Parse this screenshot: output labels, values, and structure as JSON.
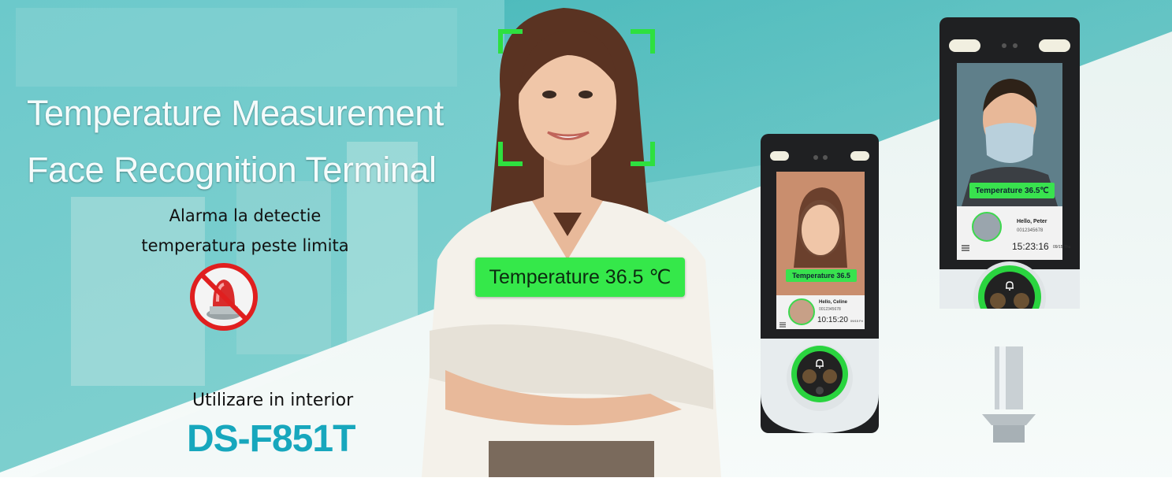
{
  "banner": {
    "title_line1": "Temperature Measurement",
    "title_line2": "Face Recognition Terminal",
    "alarm_line1": "Alarma la detectie",
    "alarm_line2": "temperatura peste limita",
    "indoor_label": "Utilizare in interior",
    "model_name": "DS-F851T",
    "temperature_badge": "Temperature 36.5 ℃"
  },
  "device_left": {
    "temperature": "Temperature 36.5",
    "greeting": "Hello, Celine",
    "id_number": "0012345678",
    "time": "10:15:20",
    "date": "09/15 Fri"
  },
  "device_right": {
    "temperature": "Temperature 36.5℃",
    "greeting": "Hello, Peter",
    "id_number": "0012345678",
    "time": "15:23:16",
    "date": "09/15 Thu"
  },
  "colors": {
    "teal_bg": "#5fc2c4",
    "accent_green": "#35e84a",
    "model_blue": "#17a7bd",
    "alarm_red": "#d92b2b"
  },
  "icons": [
    "prohibited-alarm-icon",
    "bell-icon",
    "menu-icon"
  ]
}
